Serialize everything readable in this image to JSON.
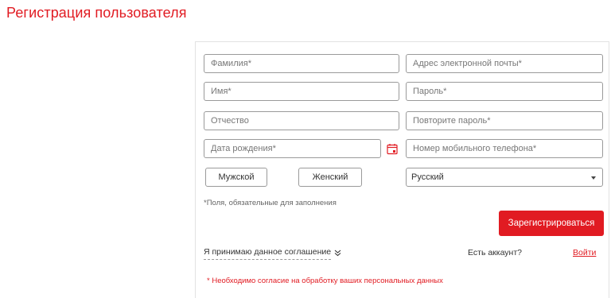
{
  "page": {
    "title": "Регистрация пользователя"
  },
  "form": {
    "last_name_placeholder": "Фамилия*",
    "email_placeholder": "Адрес электронной почты*",
    "first_name_placeholder": "Имя*",
    "password_placeholder": "Пароль*",
    "middle_name_placeholder": "Отчество",
    "password_repeat_placeholder": "Повторите пароль*",
    "birthdate_placeholder": "Дата рождения*",
    "phone_placeholder": "Номер мобильного телефона*",
    "gender_male": "Мужской",
    "gender_female": "Женский",
    "language_selected": "Русский",
    "required_note": "*Поля, обязательные для заполнения",
    "register_button": "Зарегистрироваться",
    "agreement_label": "Я принимаю данное соглашение",
    "have_account": "Есть аккаунт?",
    "login_link": "Войти",
    "consent_error": "* Необходимо согласие на обработку ваших персональных данных"
  },
  "icons": {
    "calendar": "calendar-icon",
    "expand": "double-chevron-down-icon",
    "caret": "caret-down-icon"
  },
  "colors": {
    "accent": "#e11b22",
    "border": "#9a9a9a",
    "card_border": "#e2e2e2"
  }
}
